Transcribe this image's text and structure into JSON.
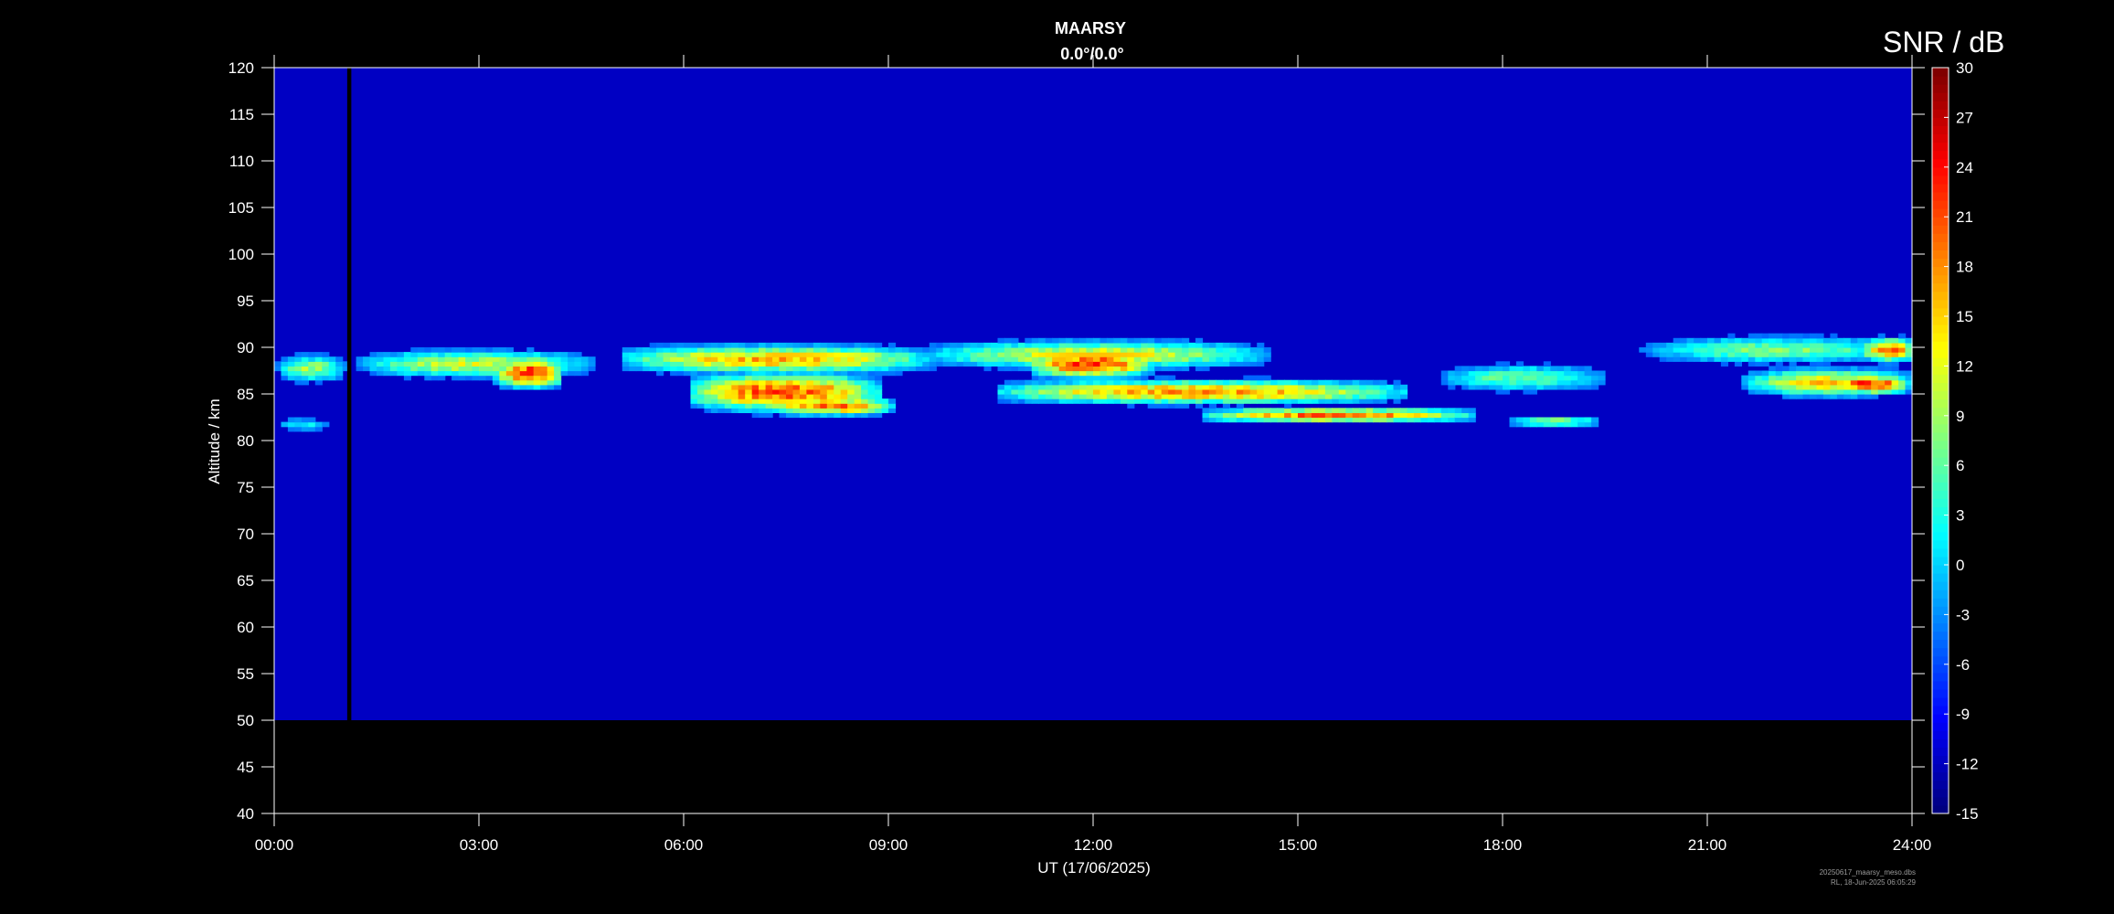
{
  "figure": {
    "title": "MAARSY",
    "subtitle": "0.0°/0.0°",
    "footer_line1": "20250617_maarsy_meso.dbs",
    "footer_line2": "RL, 18-Jun-2025 06:05:29"
  },
  "chart_data": {
    "type": "heatmap",
    "title": "MAARSY",
    "subtitle": "0.0°/0.0°",
    "xlabel": "UT (17/06/2025)",
    "ylabel": "Altitude / km",
    "x_ticks": [
      "00:00",
      "03:00",
      "06:00",
      "09:00",
      "12:00",
      "15:00",
      "18:00",
      "21:00",
      "24:00"
    ],
    "x_range_hours": [
      0,
      24
    ],
    "y_ticks": [
      40,
      45,
      50,
      55,
      60,
      65,
      70,
      75,
      80,
      85,
      90,
      95,
      100,
      105,
      110,
      115,
      120
    ],
    "y_range_km": [
      40,
      120
    ],
    "data_altitude_range_km": [
      50,
      120
    ],
    "no_data_gap_hours": [
      1.07,
      1.13
    ],
    "colorbar": {
      "label": "SNR / dB",
      "min": -15,
      "max": 30,
      "ticks": [
        30,
        27,
        24,
        21,
        18,
        15,
        12,
        9,
        6,
        3,
        0,
        -3,
        -6,
        -9,
        -12,
        -15
      ],
      "colormap": "jet"
    },
    "background_snr_db": -12,
    "echo_layers": [
      {
        "t_start": 0.0,
        "t_end": 1.0,
        "alt_center_km": 87.5,
        "thickness_km": 3.0,
        "peak_snr_db": 12
      },
      {
        "t_start": 0.0,
        "t_end": 0.8,
        "alt_center_km": 81.5,
        "thickness_km": 1.5,
        "peak_snr_db": 4
      },
      {
        "t_start": 1.2,
        "t_end": 4.6,
        "alt_center_km": 88.0,
        "thickness_km": 3.0,
        "peak_snr_db": 14
      },
      {
        "t_start": 3.2,
        "t_end": 4.2,
        "alt_center_km": 87.0,
        "thickness_km": 3.0,
        "peak_snr_db": 28
      },
      {
        "t_start": 5.0,
        "t_end": 9.6,
        "alt_center_km": 88.5,
        "thickness_km": 3.0,
        "peak_snr_db": 20
      },
      {
        "t_start": 6.0,
        "t_end": 8.8,
        "alt_center_km": 85.0,
        "thickness_km": 4.0,
        "peak_snr_db": 26
      },
      {
        "t_start": 7.2,
        "t_end": 9.0,
        "alt_center_km": 83.5,
        "thickness_km": 2.0,
        "peak_snr_db": 24
      },
      {
        "t_start": 9.5,
        "t_end": 14.5,
        "alt_center_km": 89.0,
        "thickness_km": 3.0,
        "peak_snr_db": 16
      },
      {
        "t_start": 11.0,
        "t_end": 12.8,
        "alt_center_km": 88.0,
        "thickness_km": 3.0,
        "peak_snr_db": 27
      },
      {
        "t_start": 10.5,
        "t_end": 16.5,
        "alt_center_km": 85.0,
        "thickness_km": 2.5,
        "peak_snr_db": 22
      },
      {
        "t_start": 13.5,
        "t_end": 17.5,
        "alt_center_km": 82.5,
        "thickness_km": 1.5,
        "peak_snr_db": 24
      },
      {
        "t_start": 17.0,
        "t_end": 19.5,
        "alt_center_km": 86.5,
        "thickness_km": 3.0,
        "peak_snr_db": 9
      },
      {
        "t_start": 18.0,
        "t_end": 19.4,
        "alt_center_km": 81.8,
        "thickness_km": 1.0,
        "peak_snr_db": 13
      },
      {
        "t_start": 20.0,
        "t_end": 24.0,
        "alt_center_km": 89.5,
        "thickness_km": 3.0,
        "peak_snr_db": 10
      },
      {
        "t_start": 21.5,
        "t_end": 24.0,
        "alt_center_km": 86.0,
        "thickness_km": 3.0,
        "peak_snr_db": 18
      },
      {
        "t_start": 22.8,
        "t_end": 23.9,
        "alt_center_km": 85.8,
        "thickness_km": 2.0,
        "peak_snr_db": 28
      },
      {
        "t_start": 23.2,
        "t_end": 24.0,
        "alt_center_km": 89.5,
        "thickness_km": 2.5,
        "peak_snr_db": 24
      }
    ]
  }
}
